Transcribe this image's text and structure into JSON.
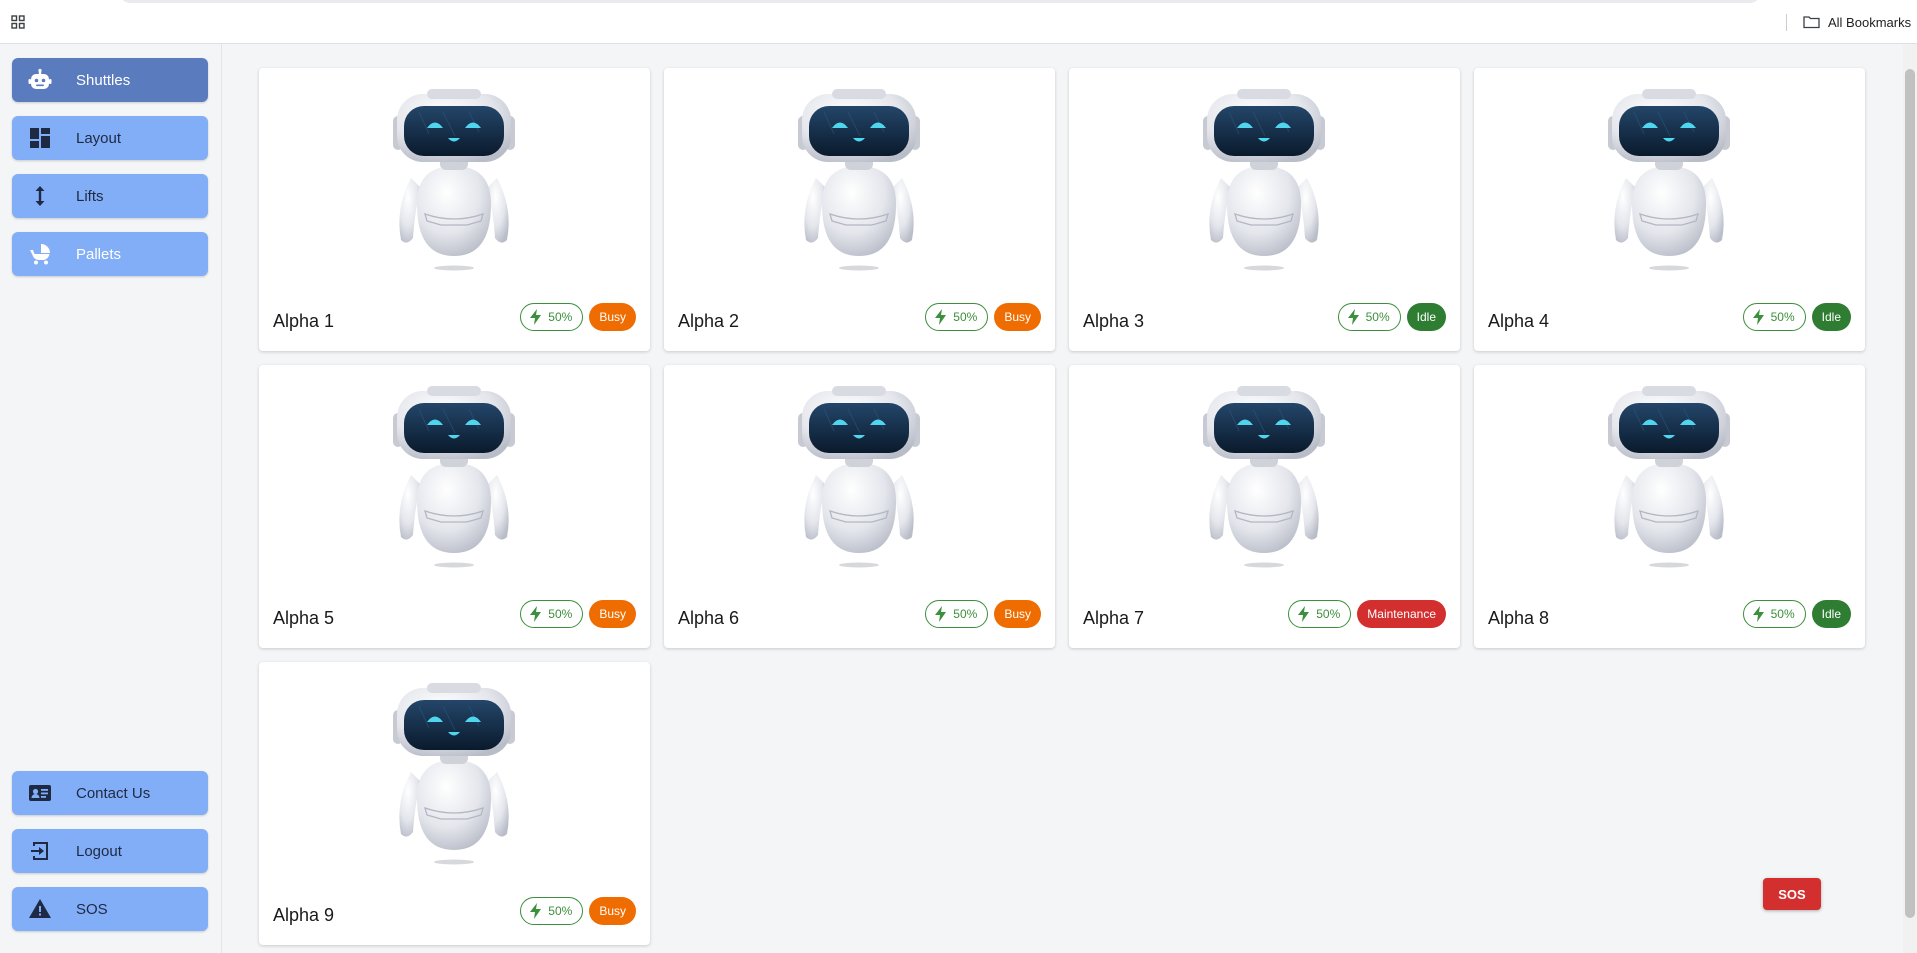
{
  "browser": {
    "all_bookmarks_label": "All Bookmarks"
  },
  "sidebar": {
    "items": [
      {
        "label": "Shuttles",
        "icon": "robot-icon",
        "active": true
      },
      {
        "label": "Layout",
        "icon": "dashboard-icon",
        "active": false
      },
      {
        "label": "Lifts",
        "icon": "vertical-arrows-icon",
        "active": false
      },
      {
        "label": "Pallets",
        "icon": "stroller-icon",
        "active": false
      }
    ],
    "bottom_items": [
      {
        "label": "Contact Us",
        "icon": "contact-card-icon"
      },
      {
        "label": "Logout",
        "icon": "logout-icon"
      },
      {
        "label": "SOS",
        "icon": "warning-icon"
      }
    ]
  },
  "shuttles": [
    {
      "name": "Alpha 1",
      "battery": "50%",
      "status": "Busy"
    },
    {
      "name": "Alpha 2",
      "battery": "50%",
      "status": "Busy"
    },
    {
      "name": "Alpha 3",
      "battery": "50%",
      "status": "Idle"
    },
    {
      "name": "Alpha 4",
      "battery": "50%",
      "status": "Idle"
    },
    {
      "name": "Alpha 5",
      "battery": "50%",
      "status": "Busy"
    },
    {
      "name": "Alpha 6",
      "battery": "50%",
      "status": "Busy"
    },
    {
      "name": "Alpha 7",
      "battery": "50%",
      "status": "Maintenance"
    },
    {
      "name": "Alpha 8",
      "battery": "50%",
      "status": "Idle"
    },
    {
      "name": "Alpha 9",
      "battery": "50%",
      "status": "Busy"
    }
  ],
  "sos_button_label": "SOS",
  "colors": {
    "nav_button": "#82adf7",
    "nav_button_active": "#5a7bbd",
    "busy": "#ef6c00",
    "idle": "#2e7d32",
    "maintenance": "#d32f2f",
    "battery": "#3c8f3c"
  }
}
